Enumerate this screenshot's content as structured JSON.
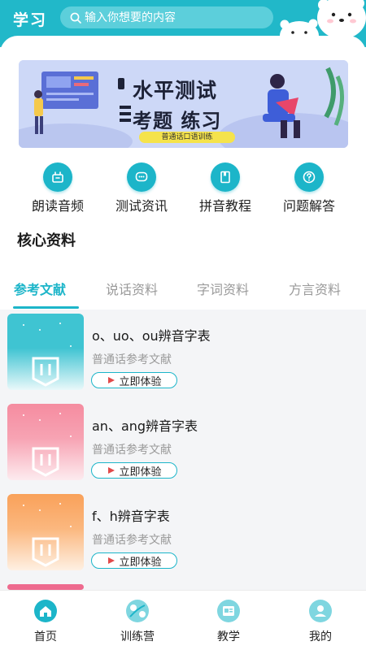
{
  "header": {
    "title": "学习",
    "search_placeholder": "输入你想要的内容"
  },
  "banner": {
    "title": "水平测试",
    "subtitle": "考题 练习",
    "tag": "普通话口语训练"
  },
  "quick_menu": [
    {
      "label": "朗读音频",
      "icon": "package-icon"
    },
    {
      "label": "测试资讯",
      "icon": "chat-icon"
    },
    {
      "label": "拼音教程",
      "icon": "book-icon"
    },
    {
      "label": "问题解答",
      "icon": "question-icon"
    }
  ],
  "section": {
    "title": "核心资料"
  },
  "tabs": [
    {
      "label": "参考文献",
      "active": true
    },
    {
      "label": "说话资料",
      "active": false
    },
    {
      "label": "字词资料",
      "active": false
    },
    {
      "label": "方言资料",
      "active": false
    }
  ],
  "items": [
    {
      "title": "o、uo、ou辨音字表",
      "subtitle": "普通话参考文献",
      "button": "立即体验",
      "color": "#3fc4d2"
    },
    {
      "title": "an、ang辨音字表",
      "subtitle": "普通话参考文献",
      "button": "立即体验",
      "color": "#f58ca0"
    },
    {
      "title": "f、h辨音字表",
      "subtitle": "普通话参考文献",
      "button": "立即体验",
      "color": "#f9a15a"
    }
  ],
  "bottom_nav": [
    {
      "label": "首页",
      "icon": "home-icon",
      "active": true
    },
    {
      "label": "训练营",
      "icon": "training-icon",
      "active": false
    },
    {
      "label": "教学",
      "icon": "teaching-icon",
      "active": false
    },
    {
      "label": "我的",
      "icon": "profile-icon",
      "active": false
    }
  ],
  "colors": {
    "accent": "#1cb5c9",
    "header": "#21b8c9"
  }
}
